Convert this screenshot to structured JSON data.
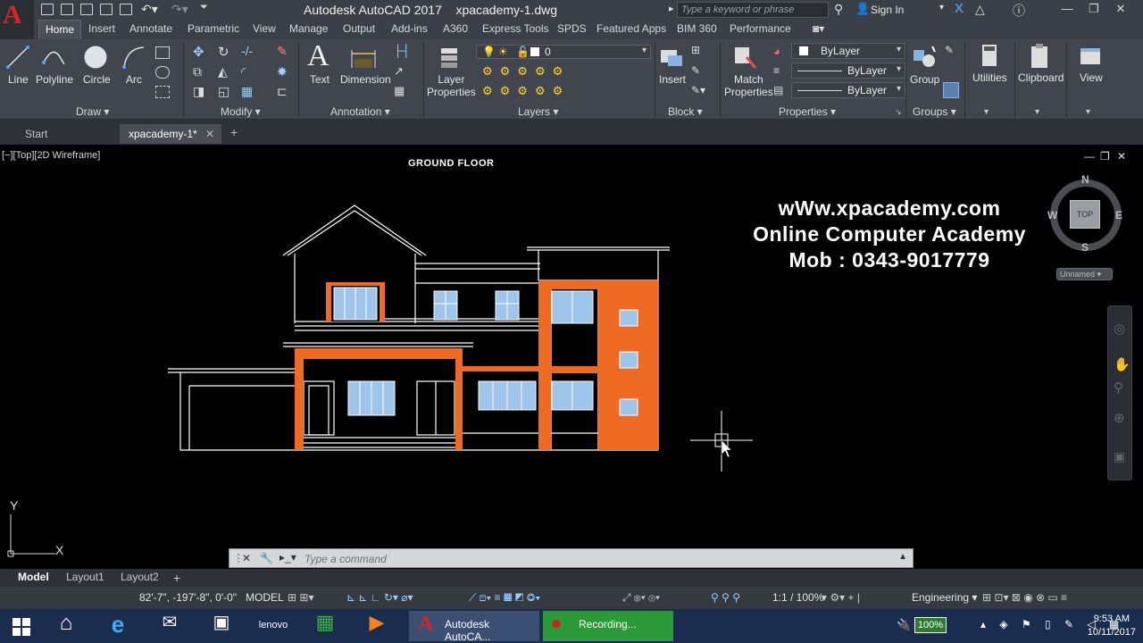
{
  "app": {
    "title": "Autodesk AutoCAD 2017",
    "filename": "xpacademy-1.dwg",
    "logo_letter": "A",
    "search_placeholder": "Type a keyword or phrase",
    "sign_in": "Sign In"
  },
  "ribbon_tabs": [
    "Home",
    "Insert",
    "Annotate",
    "Parametric",
    "View",
    "Manage",
    "Output",
    "Add-ins",
    "A360",
    "Express Tools",
    "SPDS",
    "Featured Apps",
    "BIM 360",
    "Performance"
  ],
  "ribbon": {
    "draw": {
      "title": "Draw",
      "tools": [
        "Line",
        "Polyline",
        "Circle",
        "Arc"
      ]
    },
    "modify": {
      "title": "Modify"
    },
    "annotation": {
      "title": "Annotation",
      "tools": [
        "Text",
        "Dimension"
      ]
    },
    "layers": {
      "title": "Layers",
      "tool": "Layer Properties",
      "tool_line1": "Layer",
      "tool_line2": "Properties",
      "current_layer": "0"
    },
    "block": {
      "title": "Block",
      "tool": "Insert"
    },
    "properties": {
      "title": "Properties",
      "tool_line1": "Match",
      "tool_line2": "Properties",
      "color": "ByLayer",
      "linetype": "ByLayer",
      "lineweight": "ByLayer"
    },
    "groups": {
      "title": "Groups",
      "tool": "Group"
    },
    "utilities": "Utilities",
    "clipboard": "Clipboard",
    "view": "View"
  },
  "file_tabs": [
    "Start",
    "xpacademy-1*"
  ],
  "viewport": {
    "label": "[−][Top][2D Wireframe]",
    "drawing_title": "GROUND FLOOR",
    "academy_line1": "wWw.xpacademy.com",
    "academy_line2": "Online Computer Academy",
    "academy_line3": "Mob : 0343-9017779"
  },
  "viewcube": {
    "north": "N",
    "south": "S",
    "east": "E",
    "west": "W",
    "face": "TOP",
    "ucs": "Unnamed"
  },
  "ucs_icon": {
    "x": "X",
    "y": "Y"
  },
  "command_line": {
    "placeholder": "Type a command"
  },
  "layout_tabs": [
    "Model",
    "Layout1",
    "Layout2"
  ],
  "status_bar": {
    "coords": "82'-7\", -197'-8\", 0'-0\"",
    "space": "MODEL",
    "scale": "1:1 / 100%",
    "units": "Engineering"
  },
  "taskbar": {
    "apps": [
      "Autodesk AutoCA...",
      "Recording..."
    ],
    "battery": "100%",
    "time": "9:53 AM",
    "date": "10/11/2017"
  },
  "colors": {
    "orange": "#ef6b24",
    "glass": "#9fc5ea",
    "ribbon_bg": "#41464e",
    "autocad_red": "#d8232a"
  }
}
